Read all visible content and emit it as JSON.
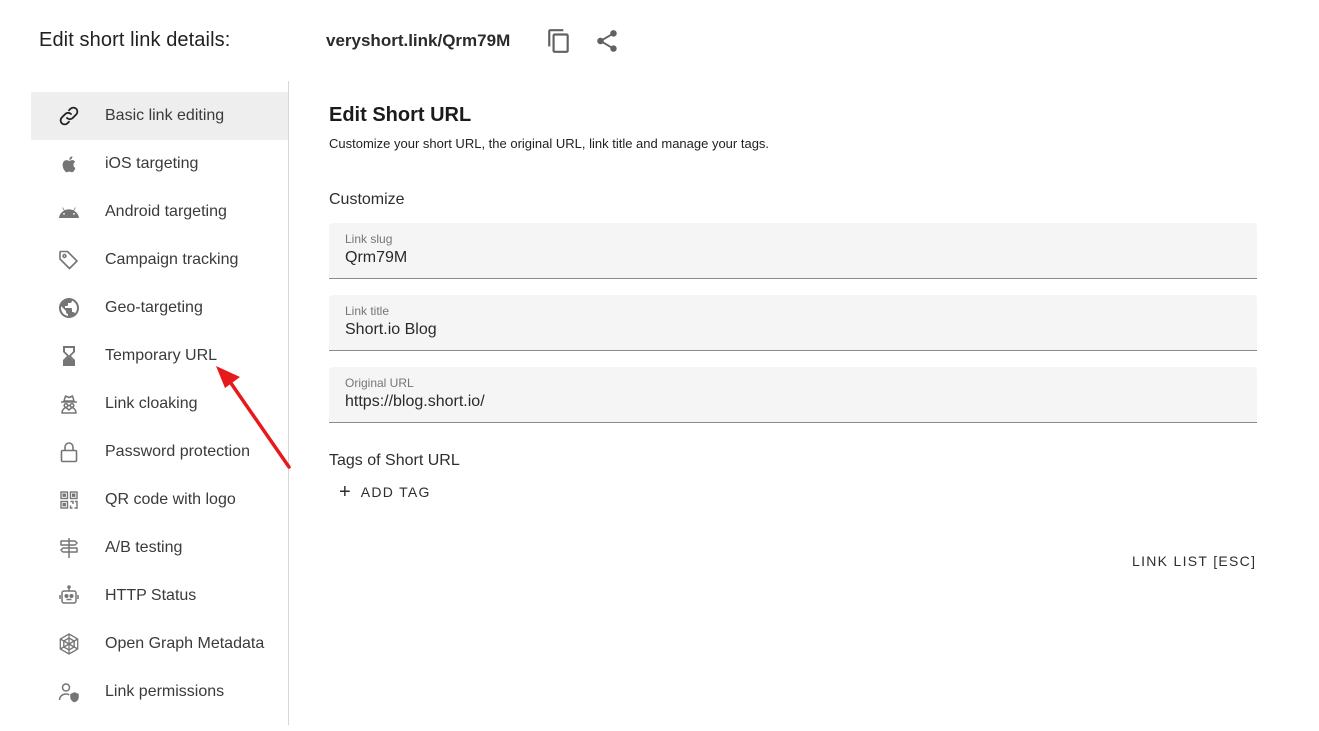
{
  "header": {
    "title": "Edit short link details:",
    "short_link": "veryshort.link/Qrm79M",
    "copy_icon": "copy-icon",
    "share_icon": "share-icon"
  },
  "sidebar": {
    "active_index": 0,
    "items": [
      {
        "label": "Basic link editing",
        "icon": "link-icon"
      },
      {
        "label": "iOS targeting",
        "icon": "apple-icon"
      },
      {
        "label": "Android targeting",
        "icon": "android-icon"
      },
      {
        "label": "Campaign tracking",
        "icon": "tag-icon"
      },
      {
        "label": "Geo-targeting",
        "icon": "globe-icon"
      },
      {
        "label": "Temporary URL",
        "icon": "hourglass-icon"
      },
      {
        "label": "Link cloaking",
        "icon": "spy-icon"
      },
      {
        "label": "Password protection",
        "icon": "lock-icon"
      },
      {
        "label": "QR code with logo",
        "icon": "qr-code-icon"
      },
      {
        "label": "A/B testing",
        "icon": "signpost-icon"
      },
      {
        "label": "HTTP Status",
        "icon": "robot-icon"
      },
      {
        "label": "Open Graph Metadata",
        "icon": "web-icon"
      },
      {
        "label": "Link permissions",
        "icon": "user-shield-icon"
      }
    ]
  },
  "main": {
    "title": "Edit Short URL",
    "subtitle": "Customize your short URL, the original URL, link title and manage your tags.",
    "customize_label": "Customize",
    "fields": [
      {
        "label": "Link slug",
        "value": "Qrm79M"
      },
      {
        "label": "Link title",
        "value": "Short.io Blog"
      },
      {
        "label": "Original URL",
        "value": "https://blog.short.io/"
      }
    ],
    "tags_label": "Tags of Short URL",
    "add_tag_label": "ADD TAG",
    "link_list_label": "LINK LIST [ESC]"
  },
  "colors": {
    "annotation_arrow": "#e8191b",
    "active_item_bg": "#eeeeee",
    "field_bg": "#f5f5f5"
  }
}
